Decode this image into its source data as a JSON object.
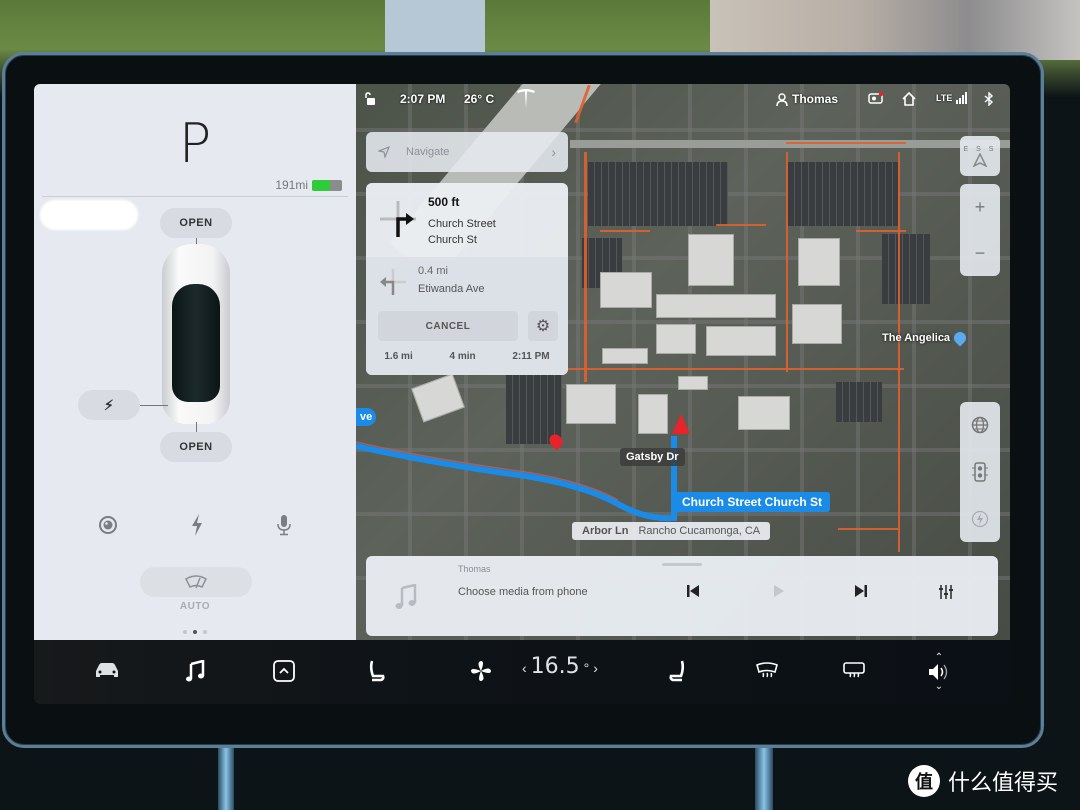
{
  "status_bar": {
    "time": "2:07 PM",
    "temperature": "26° C",
    "user": "Thomas",
    "network": "LTE",
    "icons": [
      "lock-icon",
      "tesla-logo-icon",
      "user-icon",
      "dashcam-icon",
      "home-icon",
      "lte-signal-icon",
      "bluetooth-icon"
    ]
  },
  "car_panel": {
    "gear": "P",
    "range": "191mi",
    "battery_level_fraction": 0.6,
    "battery_color": "#2fcc3a",
    "frunk_label": "OPEN",
    "trunk_label": "OPEN",
    "charge_port_icon": "lightning-icon",
    "quick_icons": [
      "camera-icon",
      "lightning-icon",
      "microphone-icon"
    ],
    "wiper_label": "AUTO",
    "page_dots": 3,
    "active_dot": 1
  },
  "navigation": {
    "search_placeholder": "Navigate",
    "primary_turn": {
      "distance": "500 ft",
      "street_line1": "Church Street",
      "street_line2": "Church St",
      "direction": "turn-right"
    },
    "secondary_turn": {
      "distance": "0.4 mi",
      "street": "Etiwanda Ave",
      "direction": "turn-left"
    },
    "cancel_label": "CANCEL",
    "trip": {
      "distance": "1.6 mi",
      "duration": "4 min",
      "arrival": "2:11 PM"
    }
  },
  "map": {
    "labels": {
      "gatsby": "Gatsby Dr",
      "current_street": "Church Street Church St",
      "arbor": "Arbor Ln",
      "city": "Rancho Cucamonga, CA",
      "poi": "The Angelica",
      "edge_label": "ve"
    },
    "route_color": "#1a8ce8",
    "traffic_color": "#e0602e",
    "controls_top": [
      "compass-icon",
      "zoom-in-icon",
      "zoom-out-icon"
    ],
    "controls_bottom": [
      "globe-icon",
      "traffic-light-icon",
      "supercharger-icon"
    ],
    "compass_letters": "E S S"
  },
  "media": {
    "source": "Thomas",
    "title": "Choose media from phone",
    "controls": [
      "previous-icon",
      "play-icon",
      "next-icon",
      "equalizer-icon"
    ]
  },
  "dock": {
    "icons": [
      "car-icon",
      "music-icon",
      "apps-up-icon",
      "seat-heater-left-icon",
      "fan-icon",
      "seat-heater-right-icon",
      "front-defrost-icon",
      "rear-defrost-icon",
      "volume-icon"
    ],
    "temperature": "16.5",
    "temp_unit": "°"
  },
  "watermark": {
    "logo": "值",
    "text": "什么值得买"
  }
}
